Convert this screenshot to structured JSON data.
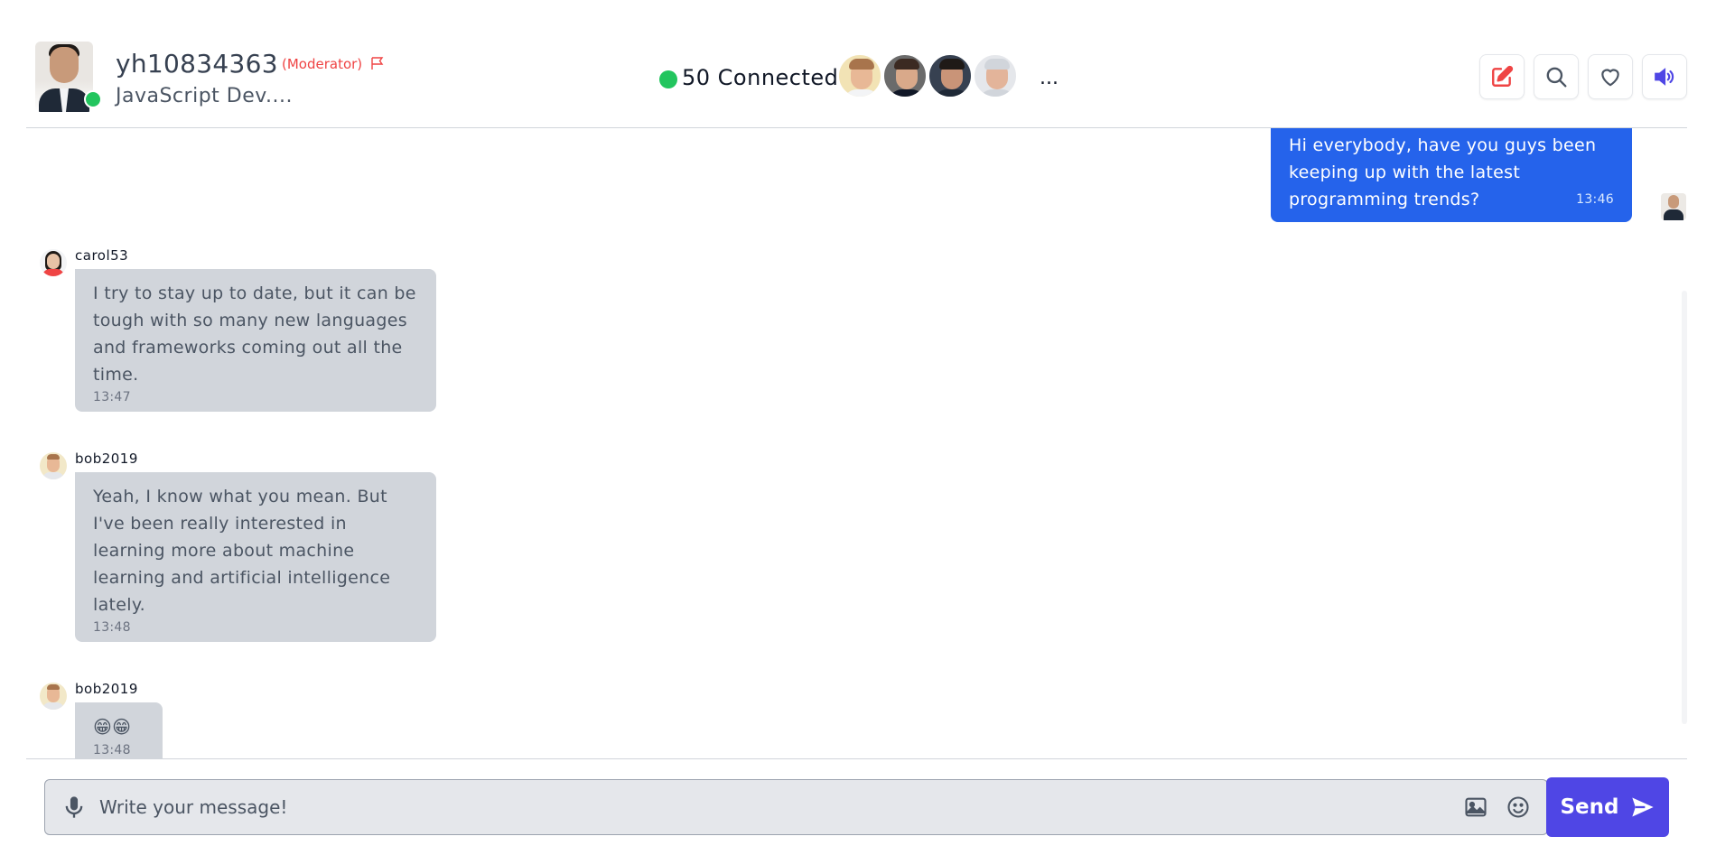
{
  "header": {
    "username": "yh10834363",
    "role": "(Moderator)",
    "subtitle": "JavaScript Dev....",
    "connected_text": "50 Connected",
    "more": "...",
    "online_status_color": "#22c55e",
    "connected_avatars": [
      {
        "skin": "#e8b896",
        "hair": "#a8744c",
        "body": "#f3f4f6",
        "bg": "#f2e3b5"
      },
      {
        "skin": "#d9a98a",
        "hair": "#3b2a22",
        "body": "#111827",
        "bg": "#6b6b6b"
      },
      {
        "skin": "#c99478",
        "hair": "#1f1a17",
        "body": "#1f2937",
        "bg": "#374151"
      },
      {
        "skin": "#e3b49a",
        "hair": "#d1d5db",
        "body": "#d1d5db",
        "bg": "#e5e7eb"
      }
    ],
    "buttons": [
      {
        "name": "edit-button",
        "icon": "edit-icon",
        "color": "#ef4444"
      },
      {
        "name": "search-button",
        "icon": "search-icon",
        "color": "#4b5563"
      },
      {
        "name": "favorite-button",
        "icon": "heart-icon",
        "color": "#4b5563"
      },
      {
        "name": "sound-button",
        "icon": "volume-icon",
        "color": "#4f46e5"
      }
    ]
  },
  "messages": [
    {
      "from": "me",
      "text": "Hi everybody, have you guys been keeping up with the latest programming trends?",
      "time": "13:46"
    },
    {
      "from": "carol53",
      "text": "I try to stay up to date, but it can be tough with so many new languages and frameworks coming out all the time.",
      "time": "13:47"
    },
    {
      "from": "bob2019",
      "text": "Yeah, I know what you mean. But I've been really interested in learning more about machine learning and artificial intelligence lately.",
      "time": "13:48"
    },
    {
      "from": "bob2019",
      "text": "😁😁",
      "time": "13:48"
    }
  ],
  "composer": {
    "placeholder": "Write your message!",
    "send_label": "Send"
  },
  "colors": {
    "accent": "#4f46e5",
    "my_bubble": "#2563eb",
    "their_bubble": "#d1d5db"
  }
}
